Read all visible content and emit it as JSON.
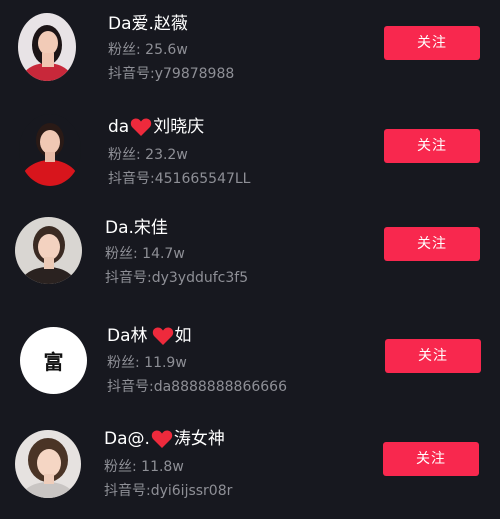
{
  "follow_label": "关注",
  "users": [
    {
      "name": "Da爱.赵薇",
      "fans": "粉丝: 25.6w",
      "douyin_id": "抖音号:y79878988"
    },
    {
      "name_prefix": "da",
      "name_suffix": "刘晓庆",
      "fans": "粉丝: 23.2w",
      "douyin_id": "抖音号:451665547LL"
    },
    {
      "name": "Da.宋佳",
      "fans": "粉丝: 14.7w",
      "douyin_id": "抖音号:dy3yddufc3f5"
    },
    {
      "avatar_text": "富",
      "name_prefix": "Da林",
      "name_suffix": "如",
      "fans": "粉丝: 11.9w",
      "douyin_id": "抖音号:da8888888866666"
    },
    {
      "name_prefix": "Da@.",
      "name_suffix": "涛女神",
      "fans": "粉丝: 11.8w",
      "douyin_id": "抖音号:dyi6ijssr08r"
    }
  ],
  "colors": {
    "background": "#17181f",
    "accent": "#f8284e",
    "secondary_text": "#8e8f96"
  },
  "icons": [
    "heart-icon"
  ]
}
